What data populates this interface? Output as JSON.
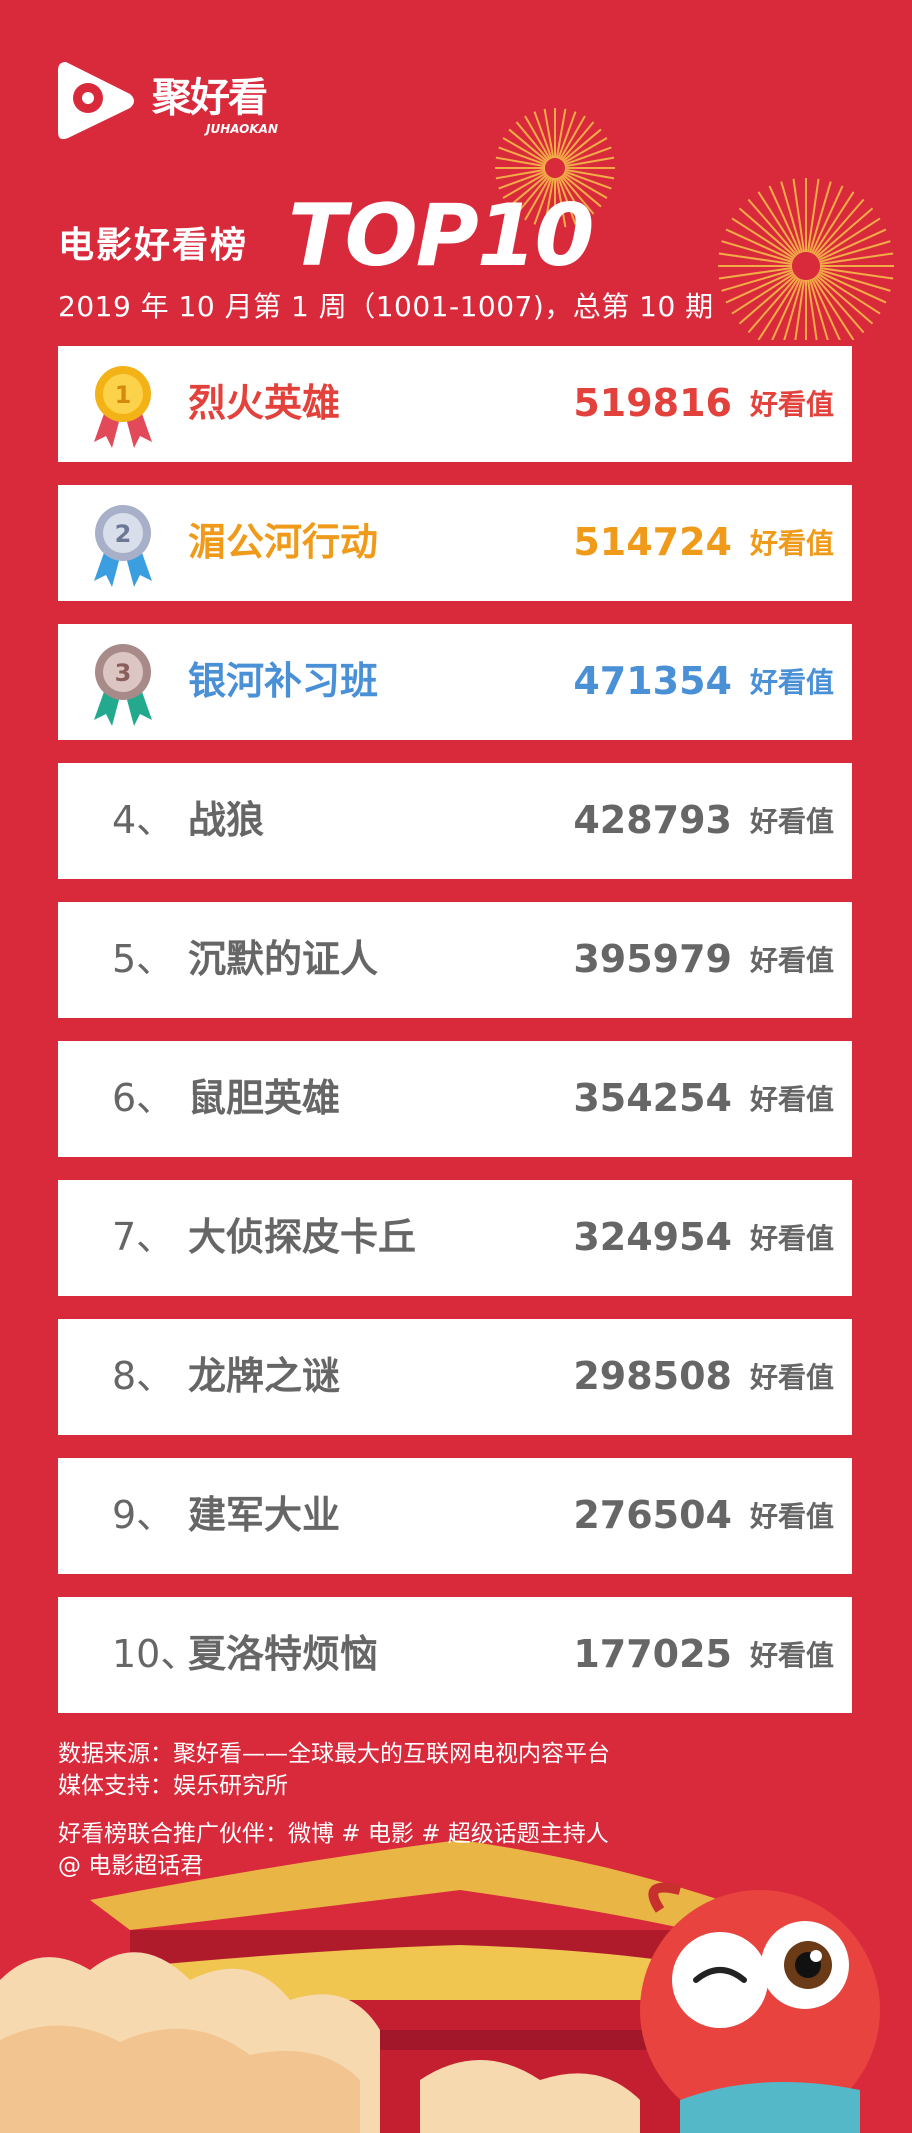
{
  "brand": {
    "name": "聚好看",
    "subname": "JUHAOKAN"
  },
  "header": {
    "title": "电影好看榜",
    "title_top": "TOP10",
    "subtitle": "2019 年 10 月第 1 周（1001-1007)，总第 10 期"
  },
  "ranking": [
    {
      "rank": "1",
      "title": "烈火英雄",
      "score": "519816",
      "unit": "好看值",
      "medal": "gold-medal",
      "color": "#e2423b"
    },
    {
      "rank": "2",
      "title": "湄公河行动",
      "score": "514724",
      "unit": "好看值",
      "medal": "silver-medal",
      "color": "#f09a1a"
    },
    {
      "rank": "3",
      "title": "银河补习班",
      "score": "471354",
      "unit": "好看值",
      "medal": "bronze-medal",
      "color": "#4a90d6"
    },
    {
      "rank": "4、",
      "title": "战狼",
      "score": "428793",
      "unit": "好看值",
      "color": "#666666"
    },
    {
      "rank": "5、",
      "title": "沉默的证人",
      "score": "395979",
      "unit": "好看值",
      "color": "#666666"
    },
    {
      "rank": "6、",
      "title": "鼠胆英雄",
      "score": "354254",
      "unit": "好看值",
      "color": "#666666"
    },
    {
      "rank": "7、",
      "title": "大侦探皮卡丘",
      "score": "324954",
      "unit": "好看值",
      "color": "#666666"
    },
    {
      "rank": "8、",
      "title": "龙牌之谜",
      "score": "298508",
      "unit": "好看值",
      "color": "#666666"
    },
    {
      "rank": "9、",
      "title": "建军大业",
      "score": "276504",
      "unit": "好看值",
      "color": "#666666"
    },
    {
      "rank": "10、",
      "title": "夏洛特烦恼",
      "score": "177025",
      "unit": "好看值",
      "color": "#666666"
    }
  ],
  "footer": {
    "source": "数据来源：聚好看——全球最大的互联网电视内容平台",
    "media": "媒体支持：娱乐研究所",
    "partners": "好看榜联合推广伙伴：微博 # 电影 # 超级话题主持人",
    "host": "@ 电影超话君"
  },
  "colors": {
    "background": "#d92a3c",
    "gold": "#e2423b",
    "silver": "#f09a1a",
    "bronze": "#4a90d6",
    "default": "#666666"
  }
}
